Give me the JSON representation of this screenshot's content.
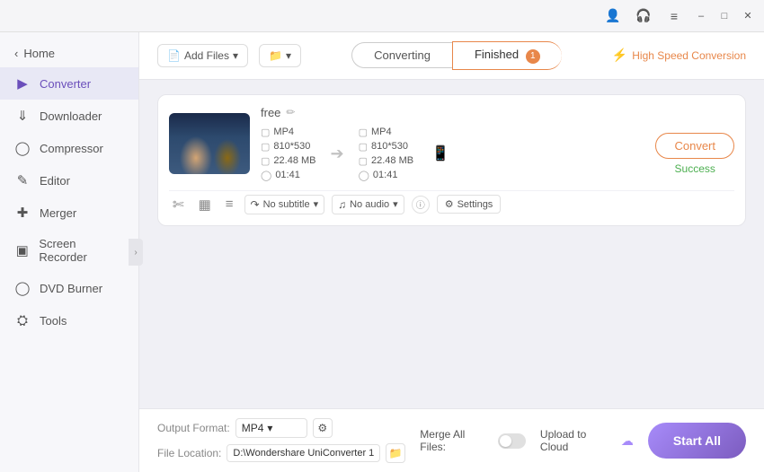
{
  "titlebar": {
    "icons": [
      "user-icon",
      "headset-icon",
      "menu-icon",
      "minimize-icon",
      "maximize-icon",
      "close-icon"
    ]
  },
  "sidebar": {
    "home_label": "Home",
    "items": [
      {
        "id": "converter",
        "label": "Converter",
        "active": true
      },
      {
        "id": "downloader",
        "label": "Downloader",
        "active": false
      },
      {
        "id": "compressor",
        "label": "Compressor",
        "active": false
      },
      {
        "id": "editor",
        "label": "Editor",
        "active": false
      },
      {
        "id": "merger",
        "label": "Merger",
        "active": false
      },
      {
        "id": "screen-recorder",
        "label": "Screen Recorder",
        "active": false
      },
      {
        "id": "dvd-burner",
        "label": "DVD Burner",
        "active": false
      },
      {
        "id": "tools",
        "label": "Tools",
        "active": false
      }
    ]
  },
  "toolbar": {
    "add_file_label": "Add Files",
    "add_folder_label": "Add Folder",
    "converting_tab": "Converting",
    "finished_tab": "Finished",
    "finished_badge": "1",
    "high_speed_label": "High Speed Conversion"
  },
  "file_card": {
    "name": "free",
    "source": {
      "format": "MP4",
      "resolution": "810*530",
      "size": "22.48 MB",
      "duration": "01:41"
    },
    "dest": {
      "format": "MP4",
      "resolution": "810*530",
      "size": "22.48 MB",
      "duration": "01:41"
    },
    "convert_btn": "Convert",
    "status": "Success",
    "subtitle_label": "No subtitle",
    "audio_label": "No audio",
    "settings_label": "Settings"
  },
  "footer": {
    "output_format_label": "Output Format:",
    "output_format_value": "MP4",
    "file_location_label": "File Location:",
    "file_location_value": "D:\\Wondershare UniConverter 1",
    "merge_label": "Merge All Files:",
    "upload_label": "Upload to Cloud",
    "start_btn_label": "Start All"
  }
}
